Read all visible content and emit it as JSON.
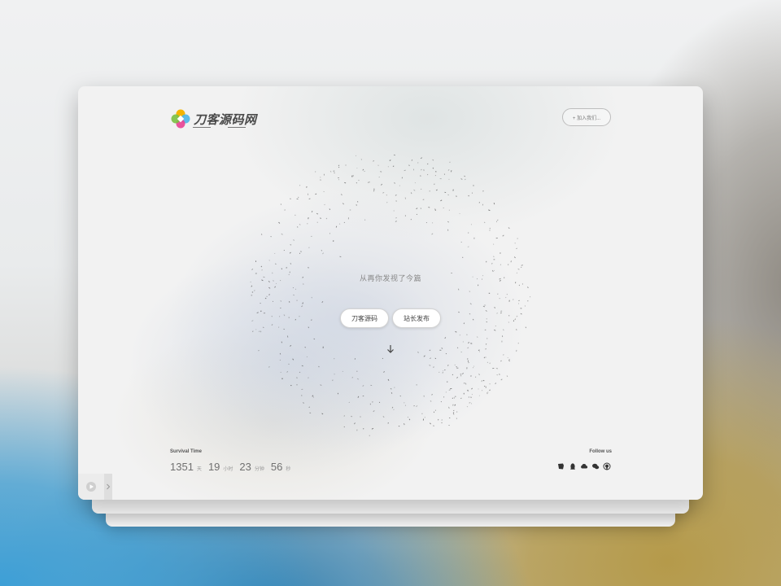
{
  "header": {
    "logo_text": "刀客源码网",
    "join_label": "+ 加入我们..."
  },
  "hero": {
    "tagline": "从再你发视了今篇",
    "button_left": "刀客源码",
    "button_right": "站长发布"
  },
  "footer": {
    "survival_label": "Survival Time",
    "days": "1351",
    "days_unit": "天",
    "hours": "19",
    "hours_unit": "小时",
    "minutes": "23",
    "minutes_unit": "分钟",
    "seconds": "56",
    "seconds_unit": "秒",
    "follow_label": "Follow us",
    "social_icons": [
      "weibo-icon",
      "qq-icon",
      "cloud-icon",
      "wechat-icon",
      "github-icon"
    ]
  },
  "colors": {
    "card_bg": "#f2f2f2",
    "text_muted": "#888888",
    "button_border": "#d3d3d3"
  }
}
